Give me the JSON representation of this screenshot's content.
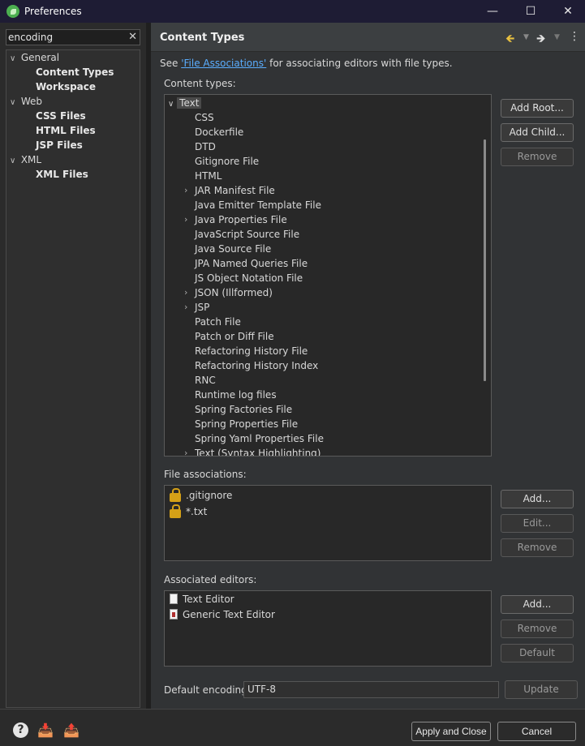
{
  "window": {
    "title": "Preferences"
  },
  "left": {
    "filter_value": "encoding",
    "tree": [
      {
        "label": "General",
        "level": 0,
        "expanded": true
      },
      {
        "label": "Content Types",
        "level": 1,
        "selected": true
      },
      {
        "label": "Workspace",
        "level": 1
      },
      {
        "label": "Web",
        "level": 0,
        "expanded": true
      },
      {
        "label": "CSS Files",
        "level": 1
      },
      {
        "label": "HTML Files",
        "level": 1
      },
      {
        "label": "JSP Files",
        "level": 1
      },
      {
        "label": "XML",
        "level": 0,
        "expanded": true
      },
      {
        "label": "XML Files",
        "level": 1
      }
    ]
  },
  "header": {
    "title": "Content Types"
  },
  "see": {
    "prefix": "See ",
    "link": "'File Associations'",
    "suffix": " for associating editors with file types."
  },
  "content_types": {
    "label": "Content types:",
    "root": "Text",
    "items": [
      {
        "label": "CSS",
        "expandable": false
      },
      {
        "label": "Dockerfile",
        "expandable": false
      },
      {
        "label": "DTD",
        "expandable": false
      },
      {
        "label": "Gitignore File",
        "expandable": false
      },
      {
        "label": "HTML",
        "expandable": false
      },
      {
        "label": "JAR Manifest File",
        "expandable": true
      },
      {
        "label": "Java Emitter Template File",
        "expandable": false
      },
      {
        "label": "Java Properties File",
        "expandable": true
      },
      {
        "label": "JavaScript Source File",
        "expandable": false
      },
      {
        "label": "Java Source File",
        "expandable": false
      },
      {
        "label": "JPA Named Queries File",
        "expandable": false
      },
      {
        "label": "JS Object Notation File",
        "expandable": false
      },
      {
        "label": "JSON (Illformed)",
        "expandable": true
      },
      {
        "label": "JSP",
        "expandable": true
      },
      {
        "label": "Patch File",
        "expandable": false
      },
      {
        "label": "Patch or Diff File",
        "expandable": false
      },
      {
        "label": "Refactoring History File",
        "expandable": false
      },
      {
        "label": "Refactoring History Index",
        "expandable": false
      },
      {
        "label": "RNC",
        "expandable": false
      },
      {
        "label": "Runtime log files",
        "expandable": false
      },
      {
        "label": "Spring Factories File",
        "expandable": false
      },
      {
        "label": "Spring Properties File",
        "expandable": false
      },
      {
        "label": "Spring Yaml Properties File",
        "expandable": false
      },
      {
        "label": "Text (Syntax Highlighting)",
        "expandable": true
      }
    ],
    "buttons": {
      "add_root": "Add Root...",
      "add_child": "Add Child...",
      "remove": "Remove"
    }
  },
  "file_associations": {
    "label": "File associations:",
    "items": [
      ".gitignore",
      "*.txt"
    ],
    "buttons": {
      "add": "Add...",
      "edit": "Edit...",
      "remove": "Remove"
    }
  },
  "associated_editors": {
    "label": "Associated editors:",
    "items": [
      "Text Editor",
      "Generic Text Editor"
    ],
    "buttons": {
      "add": "Add...",
      "remove": "Remove",
      "default": "Default"
    }
  },
  "encoding": {
    "label": "Default encoding:",
    "value": "UTF-8",
    "update": "Update"
  },
  "footer": {
    "apply_close": "Apply and Close",
    "cancel": "Cancel"
  }
}
